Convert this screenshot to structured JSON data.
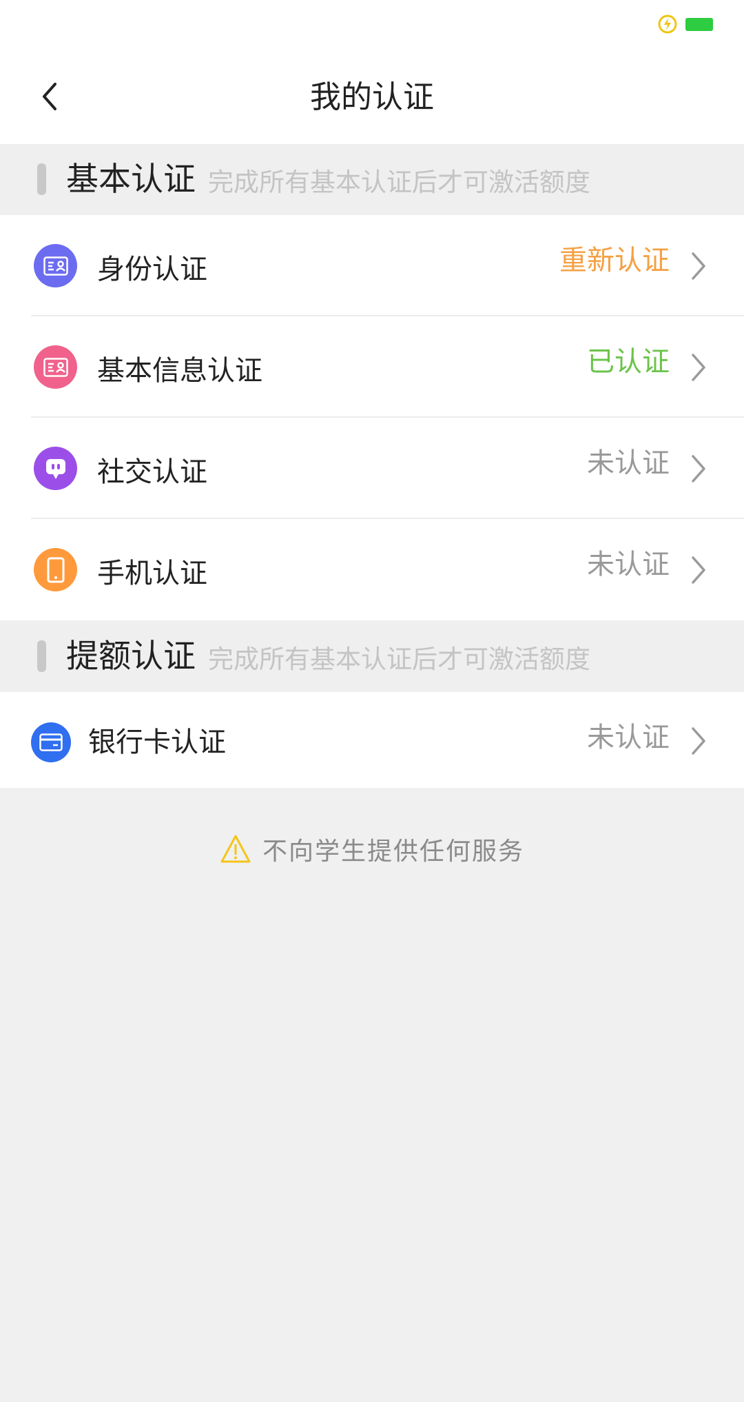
{
  "header": {
    "title": "我的认证"
  },
  "basic_section": {
    "title": "基本认证",
    "subtitle": "完成所有基本认证后才可激活额度",
    "items": [
      {
        "label": "身份认证",
        "status": "重新认证",
        "status_color": "#f5a043",
        "icon": "id-card-icon",
        "icon_bg": "#6c6cf0"
      },
      {
        "label": "基本信息认证",
        "status": "已认证",
        "status_color": "#6cc34a",
        "icon": "id-card-icon",
        "icon_bg": "#f0628c"
      },
      {
        "label": "社交认证",
        "status": "未认证",
        "status_color": "#999999",
        "icon": "chat-bubble-icon",
        "icon_bg": "#9b4fe8"
      },
      {
        "label": "手机认证",
        "status": "未认证",
        "status_color": "#999999",
        "icon": "phone-icon",
        "icon_bg": "#ff9a3c"
      }
    ]
  },
  "limit_section": {
    "title": "提额认证",
    "subtitle": "完成所有基本认证后才可激活额度",
    "items": [
      {
        "label": "银行卡认证",
        "status": "未认证",
        "status_color": "#999999",
        "icon": "bank-card-icon",
        "icon_bg": "#2f6ff0"
      }
    ]
  },
  "notice": {
    "text": "不向学生提供任何服务",
    "icon": "warning-icon",
    "icon_color": "#f5c518"
  },
  "colors": {
    "accent_orange": "#f5a043",
    "verified_green": "#6cc34a",
    "battery_green": "#2ecc40"
  }
}
